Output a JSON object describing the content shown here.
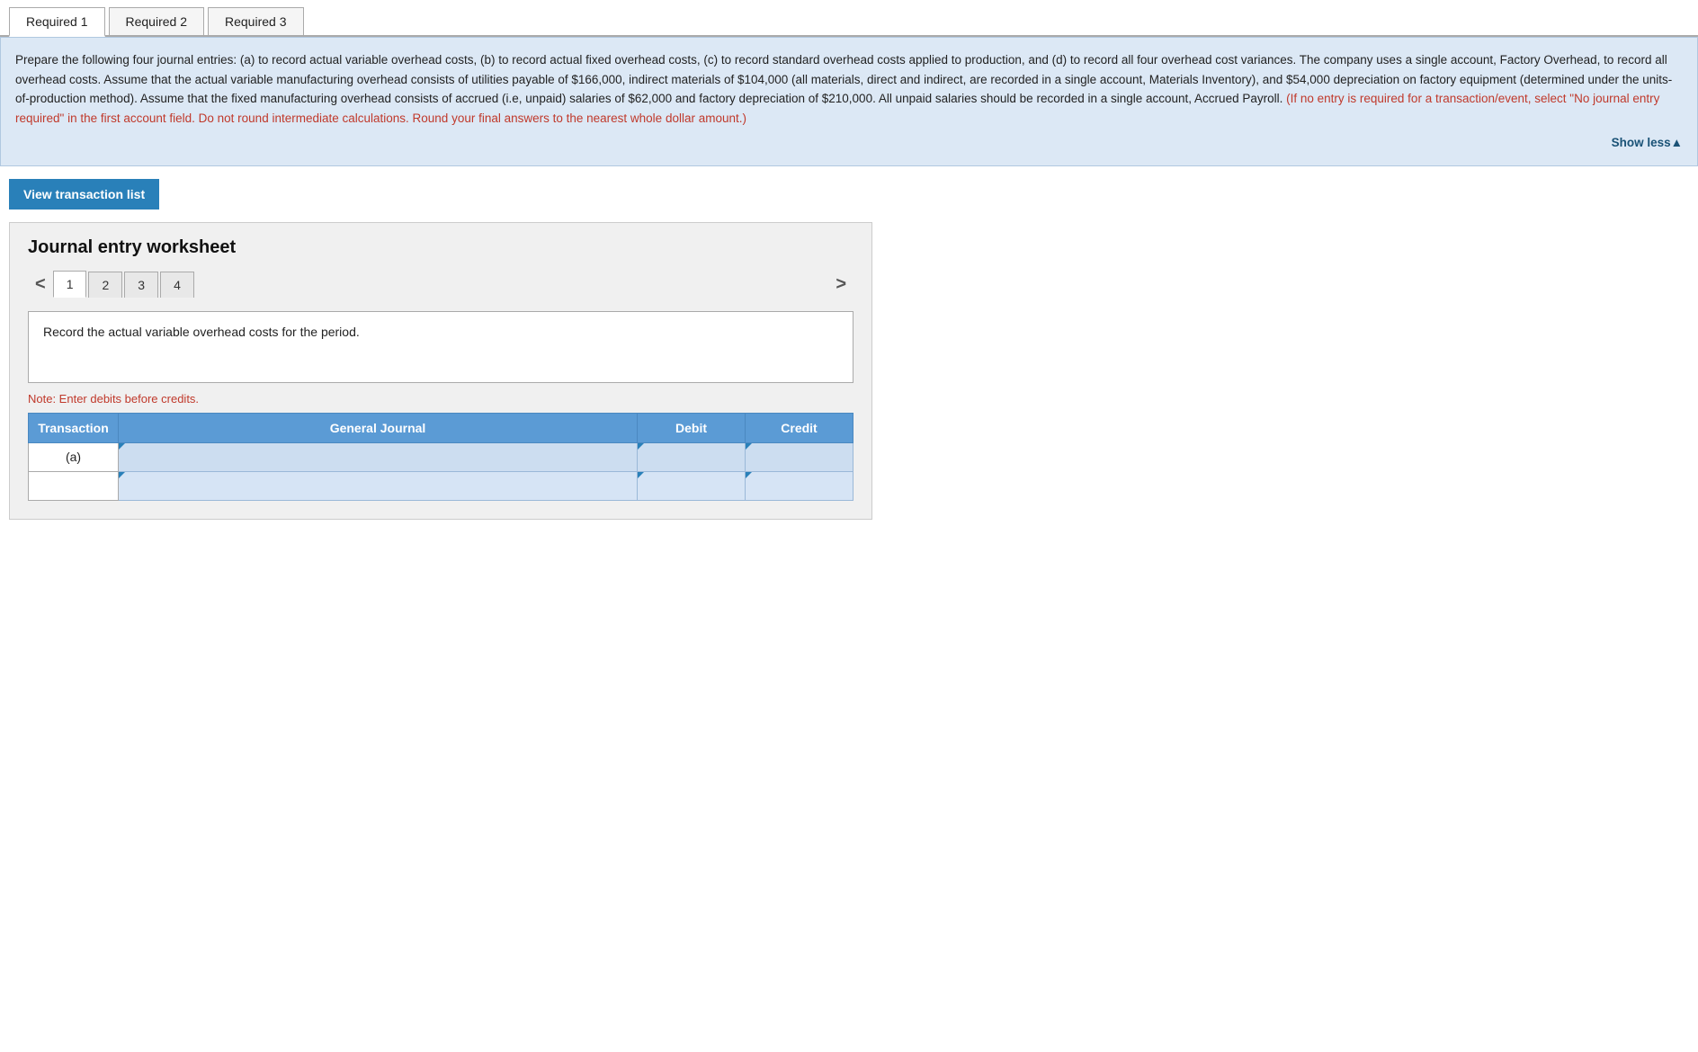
{
  "tabs": [
    {
      "label": "Required 1",
      "active": true
    },
    {
      "label": "Required 2",
      "active": false
    },
    {
      "label": "Required 3",
      "active": false
    }
  ],
  "instructions": {
    "main_text": "Prepare the following four journal entries: (a) to record actual variable overhead costs, (b) to record actual fixed overhead costs, (c) to record standard overhead costs applied to production, and (d) to record all four overhead cost variances. The company uses a single account, Factory Overhead, to record all overhead costs. Assume that the actual variable manufacturing overhead consists of utilities payable of $166,000, indirect materials of $104,000 (all materials, direct and indirect, are recorded in a single account, Materials Inventory), and $54,000 depreciation on factory equipment (determined under the units-of-production method). Assume that the fixed manufacturing overhead consists of accrued (i.e, unpaid) salaries of $62,000 and factory depreciation of $210,000. All unpaid salaries should be recorded in a single account, Accrued Payroll.",
    "red_text": "(If no entry is required for a transaction/event, select \"No journal entry required\" in the first account field. Do not round intermediate calculations. Round your final answers to the nearest whole dollar amount.)",
    "show_less_label": "Show less▲"
  },
  "view_transaction_button": "View transaction list",
  "worksheet": {
    "title": "Journal entry worksheet",
    "pages": [
      {
        "label": "1",
        "active": true
      },
      {
        "label": "2",
        "active": false
      },
      {
        "label": "3",
        "active": false
      },
      {
        "label": "4",
        "active": false
      }
    ],
    "entry_description": "Record the actual variable overhead costs for the period.",
    "note": "Note: Enter debits before credits.",
    "table": {
      "headers": [
        "Transaction",
        "General Journal",
        "Debit",
        "Credit"
      ],
      "rows": [
        {
          "transaction": "(a)",
          "general_journal": "",
          "debit": "",
          "credit": ""
        },
        {
          "transaction": "",
          "general_journal": "",
          "debit": "",
          "credit": ""
        }
      ]
    }
  }
}
